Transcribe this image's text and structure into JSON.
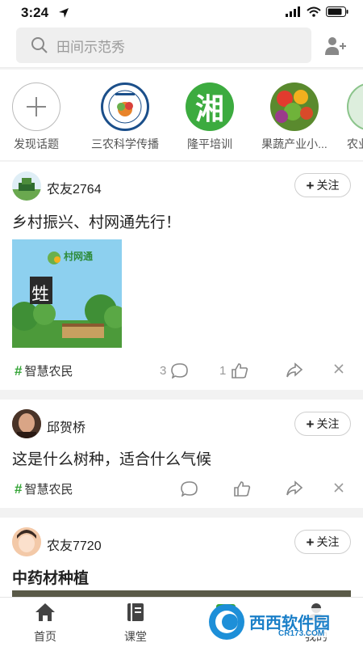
{
  "status": {
    "time": "3:24"
  },
  "search": {
    "placeholder": "田间示范秀"
  },
  "topics": [
    {
      "label": "发现话题"
    },
    {
      "label": "三农科学传播"
    },
    {
      "label": "隆平培训",
      "logo_text": "湘"
    },
    {
      "label": "果蔬产业小..."
    },
    {
      "label": "农业"
    }
  ],
  "posts": [
    {
      "user": "农友2764",
      "follow": "关注",
      "text": "乡村振兴、村网通先行！",
      "image_title": "村网通",
      "image_char": "甡",
      "tag": "智慧农民",
      "comments": "3",
      "likes": "1"
    },
    {
      "user": "邱贺桥",
      "follow": "关注",
      "text": "这是什么树种，适合什么气候",
      "tag": "智慧农民"
    },
    {
      "user": "农友7720",
      "follow": "关注",
      "text": "中药材种植"
    }
  ],
  "tabbar": [
    {
      "label": "首页"
    },
    {
      "label": "课堂"
    },
    {
      "label": ""
    },
    {
      "label": "我的"
    }
  ],
  "watermark": {
    "brand": "西西软件园",
    "url": "CR173.COM"
  },
  "colors": {
    "accent": "#35a537",
    "bg": "#f2f2f2"
  }
}
